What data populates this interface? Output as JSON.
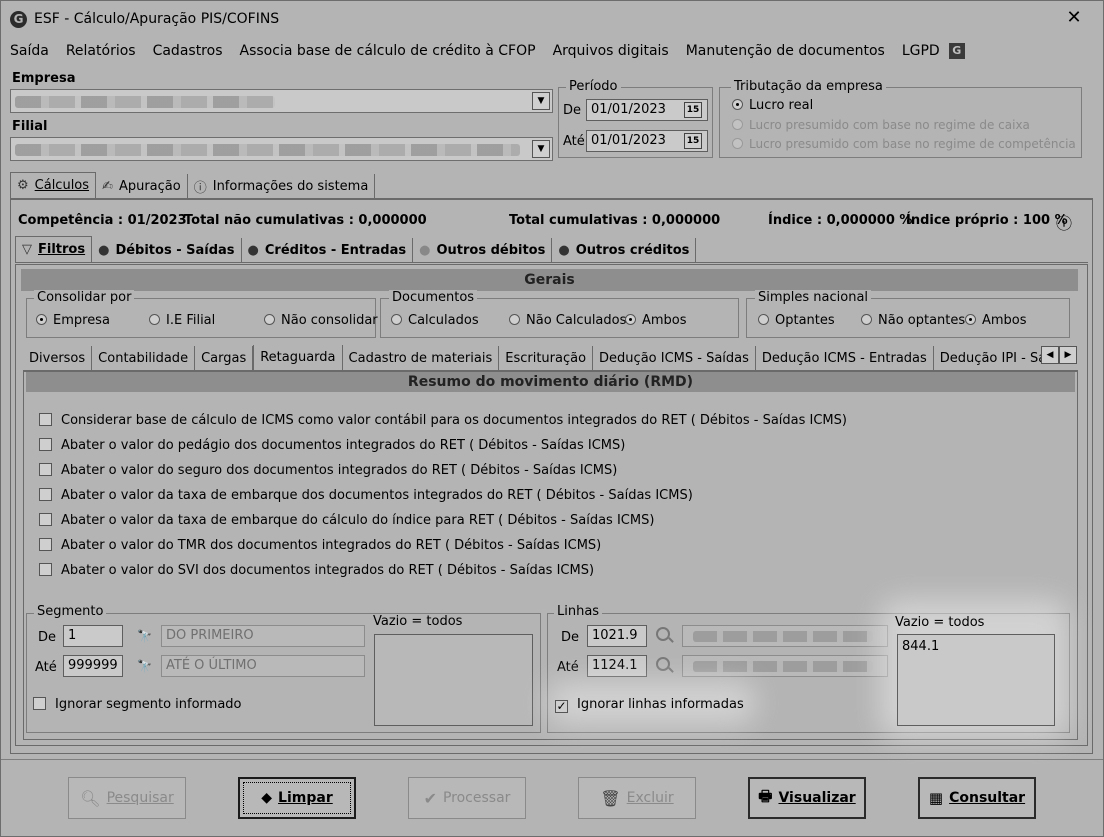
{
  "window": {
    "title": "ESF - Cálculo/Apuração PIS/COFINS",
    "app_icon": "G",
    "close": "✕"
  },
  "menu": {
    "items": [
      "Saída",
      "Relatórios",
      "Cadastros",
      "Associa base de cálculo de crédito à CFOP",
      "Arquivos digitais",
      "Manutenção de documentos",
      "LGPD"
    ]
  },
  "empresa": {
    "label": "Empresa"
  },
  "filial": {
    "label": "Filial"
  },
  "periodo": {
    "legend": "Período",
    "de_label": "De",
    "de_value": "01/01/2023",
    "ate_label": "Até",
    "ate_value": "01/01/2023",
    "cal_icon": "15"
  },
  "tributacao": {
    "legend": "Tributação da empresa",
    "options": [
      "Lucro real",
      "Lucro presumido com base no regime de caixa",
      "Lucro presumido com base no regime de competência"
    ],
    "selected": "Lucro real"
  },
  "main_tabs": [
    "Cálculos",
    "Apuração",
    "Informações do sistema"
  ],
  "status": {
    "competencia": "Competência : 01/2023",
    "total_nao_cumulativas": "Total não cumulativas : 0,000000",
    "total_cumulativas": "Total cumulativas : 0,000000",
    "indice": "Índice : 0,000000 %",
    "indice_proprio": "Índice próprio : 100 %"
  },
  "sub_tabs": [
    "Filtros",
    "Débitos - Saídas",
    "Créditos - Entradas",
    "Outros débitos",
    "Outros créditos"
  ],
  "gerais": {
    "title": "Gerais",
    "consolidar": {
      "legend": "Consolidar por",
      "options": [
        "Empresa",
        "I.E Filial",
        "Não consolidar"
      ],
      "selected": "Empresa"
    },
    "documentos": {
      "legend": "Documentos",
      "options": [
        "Calculados",
        "Não Calculados",
        "Ambos"
      ],
      "selected": "Ambos"
    },
    "simples": {
      "legend": "Simples nacional",
      "options": [
        "Optantes",
        "Não optantes",
        "Ambos"
      ],
      "selected": "Ambos"
    }
  },
  "inner_tabs": [
    "Diversos",
    "Contabilidade",
    "Cargas",
    "Retaguarda",
    "Cadastro de materiais",
    "Escrituração",
    "Dedução ICMS - Saídas",
    "Dedução ICMS - Entradas",
    "Dedução IPI - Saídas"
  ],
  "rmd": {
    "title": "Resumo do movimento diário (RMD)",
    "checks": [
      "Considerar base de cálculo de ICMS como valor contábil para os documentos integrados do RET ( Débitos - Saídas ICMS)",
      "Abater o valor do pedágio dos documentos integrados do RET ( Débitos - Saídas ICMS)",
      "Abater o valor do seguro dos documentos integrados do RET ( Débitos - Saídas ICMS)",
      "Abater o valor da taxa de embarque dos documentos integrados do RET ( Débitos - Saídas ICMS)",
      "Abater o valor da taxa de embarque do cálculo do índice para RET ( Débitos - Saídas ICMS)",
      "Abater o valor do TMR dos documentos integrados do RET ( Débitos - Saídas ICMS)",
      "Abater o valor do SVI dos documentos integrados do RET ( Débitos - Saídas ICMS)"
    ]
  },
  "segmento": {
    "legend": "Segmento",
    "de_label": "De",
    "de_value": "1",
    "de_desc": "DO PRIMEIRO",
    "ate_label": "Até",
    "ate_value": "999999",
    "ate_desc": "ATÉ O ÚLTIMO",
    "vazio_label": "Vazio = todos",
    "ignorar": "Ignorar segmento informado",
    "ignorar_checked": false
  },
  "linhas": {
    "legend": "Linhas",
    "de_label": "De",
    "de_value": "1021.9",
    "ate_label": "Até",
    "ate_value": "1124.1",
    "vazio_label": "Vazio = todos",
    "list_value": "844.1",
    "ignorar": "Ignorar linhas informadas",
    "ignorar_checked": true
  },
  "buttons": {
    "pesquisar": "Pesquisar",
    "limpar": "Limpar",
    "processar": "Processar",
    "excluir": "Excluir",
    "visualizar": "Visualizar",
    "consultar": "Consultar"
  }
}
